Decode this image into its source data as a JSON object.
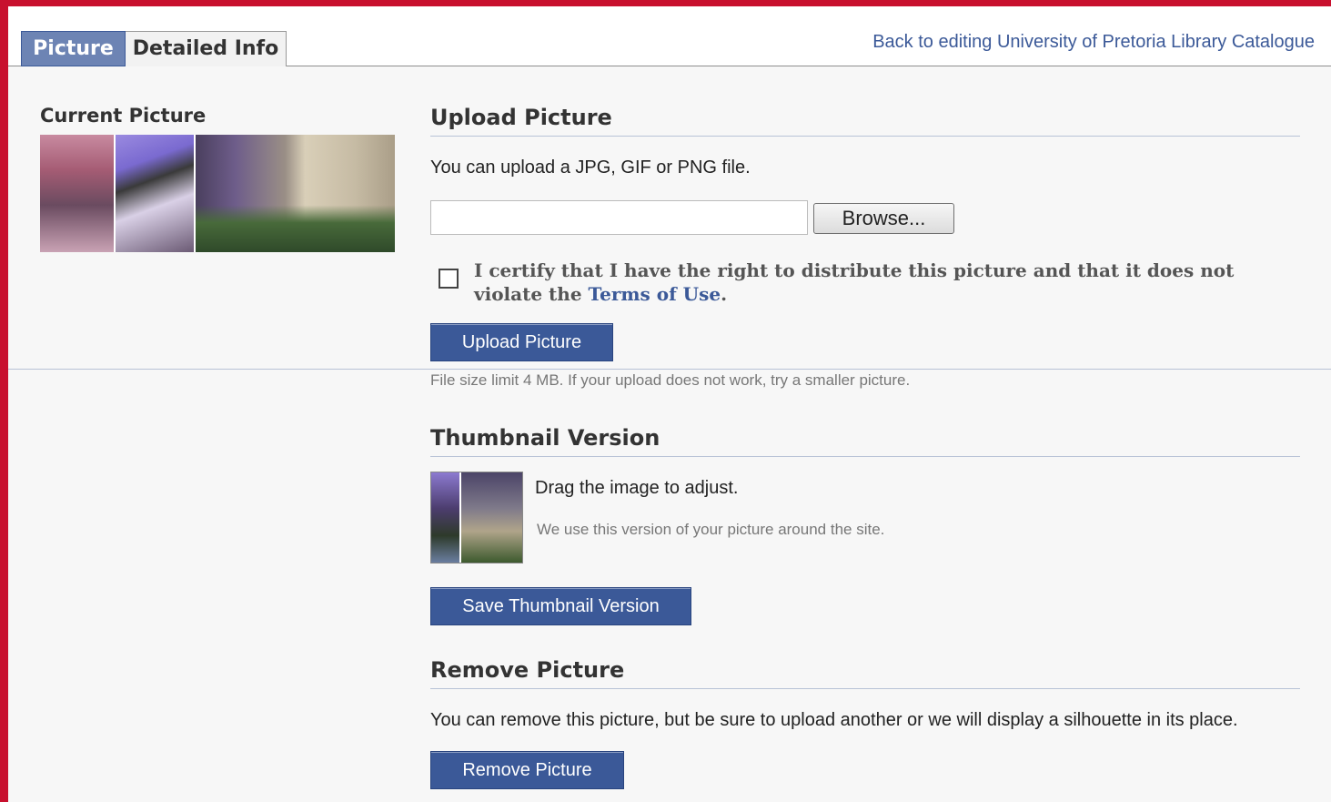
{
  "tabs": [
    {
      "label": "Picture",
      "active": true
    },
    {
      "label": "Detailed Info",
      "active": false
    }
  ],
  "back_link": "Back to editing University of Pretoria Library Catalogue",
  "current_picture": {
    "label": "Current Picture"
  },
  "upload": {
    "title": "Upload Picture",
    "description": "You can upload a JPG, GIF or PNG file.",
    "file_value": "",
    "browse_label": "Browse...",
    "certify_text": "I certify that I have the right to distribute this picture and that it does not violate the",
    "terms_link": "Terms of Use",
    "certify_end": ".",
    "checkbox_checked": false,
    "button_label": "Upload Picture",
    "size_note": "File size limit 4 MB. If your upload does not work, try a smaller picture."
  },
  "thumbnail": {
    "title": "Thumbnail Version",
    "drag_text": "Drag the image to adjust.",
    "note": "We use this version of your picture around the site.",
    "button_label": "Save Thumbnail Version"
  },
  "remove": {
    "title": "Remove Picture",
    "description": "You can remove this picture, but be sure to upload another or we will display a silhouette in its place.",
    "button_label": "Remove Picture"
  },
  "colors": {
    "accent": "#3b5998",
    "frame": "#c8102e",
    "tab_active": "#6d84b4"
  }
}
